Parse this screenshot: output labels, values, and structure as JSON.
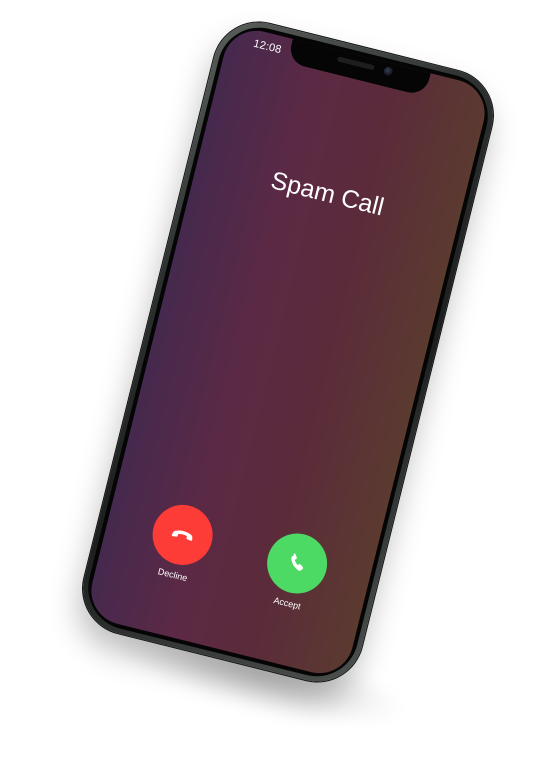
{
  "status_bar": {
    "time": "12:08"
  },
  "call": {
    "caller_name": "Spam Call"
  },
  "actions": {
    "decline_label": "Decline",
    "accept_label": "Accept",
    "decline_icon": "phone-hangup-icon",
    "accept_icon": "phone-icon"
  },
  "colors": {
    "decline": "#fd3b37",
    "accept": "#4cd964",
    "background_start": "#46294f",
    "background_end": "#5b3a30"
  }
}
